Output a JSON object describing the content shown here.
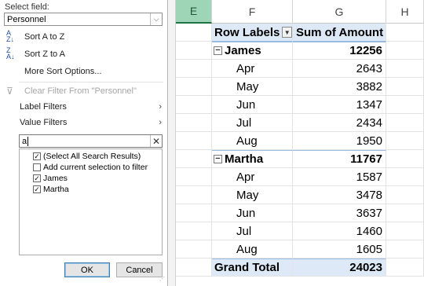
{
  "filter_panel": {
    "select_field_label": "Select field:",
    "select_field_value": "Personnel",
    "sort_az": "Sort A to Z",
    "sort_za": "Sort Z to A",
    "more_sort": "More Sort Options...",
    "clear_filter": "Clear Filter From \"Personnel\"",
    "label_filters": "Label Filters",
    "value_filters": "Value Filters",
    "search_value": "a",
    "list": [
      {
        "label": "(Select All Search Results)",
        "checked": true
      },
      {
        "label": "Add current selection to filter",
        "checked": false
      },
      {
        "label": "James",
        "checked": true
      },
      {
        "label": "Martha",
        "checked": true
      }
    ],
    "ok_label": "OK",
    "cancel_label": "Cancel"
  },
  "sheet": {
    "columns": [
      "E",
      "F",
      "G",
      "H"
    ],
    "selected_column": "E",
    "pivot": {
      "row_labels_header": "Row Labels",
      "value_header": "Sum of Amount",
      "groups": [
        {
          "name": "James",
          "total": "12256",
          "items": [
            {
              "label": "Apr",
              "value": "2643"
            },
            {
              "label": "May",
              "value": "3882"
            },
            {
              "label": "Jun",
              "value": "1347"
            },
            {
              "label": "Jul",
              "value": "2434"
            },
            {
              "label": "Aug",
              "value": "1950"
            }
          ]
        },
        {
          "name": "Martha",
          "total": "11767",
          "items": [
            {
              "label": "Apr",
              "value": "1587"
            },
            {
              "label": "May",
              "value": "3478"
            },
            {
              "label": "Jun",
              "value": "3637"
            },
            {
              "label": "Jul",
              "value": "1460"
            },
            {
              "label": "Aug",
              "value": "1605"
            }
          ]
        }
      ],
      "grand_total_label": "Grand Total",
      "grand_total_value": "24023"
    }
  }
}
